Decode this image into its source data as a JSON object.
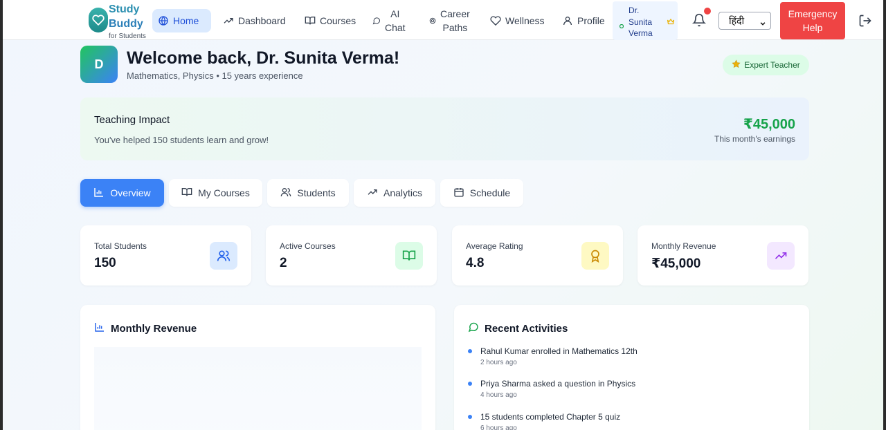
{
  "brand": {
    "line1": "Study",
    "line2": "Buddy",
    "subtitle": "for Students"
  },
  "nav": {
    "home": "Home",
    "dashboard": "Dashboard",
    "courses": "Courses",
    "ai_chat": [
      "AI",
      "Chat"
    ],
    "career_paths": [
      "Career",
      "Paths"
    ],
    "wellness": "Wellness",
    "profile": "Profile"
  },
  "user_chip": {
    "name_lines": [
      "Dr.",
      "Sunita",
      "Verma"
    ]
  },
  "language": {
    "selected": "हिंदी"
  },
  "emergency": {
    "lines": [
      "Emergency",
      "Help"
    ]
  },
  "welcome": {
    "avatar_letter": "D",
    "title": "Welcome back, Dr. Sunita Verma!",
    "subtitle": "Mathematics, Physics • 15 years experience",
    "badge": "Expert Teacher"
  },
  "impact": {
    "title": "Teaching Impact",
    "subtitle": "You've helped 150 students learn and grow!",
    "amount": "₹45,000",
    "caption": "This month's earnings"
  },
  "tabs": [
    "Overview",
    "My Courses",
    "Students",
    "Analytics",
    "Schedule"
  ],
  "stats": [
    {
      "label": "Total Students",
      "value": "150",
      "icon": "users-icon",
      "bg": "#dbeafe",
      "color": "#2563eb"
    },
    {
      "label": "Active Courses",
      "value": "2",
      "icon": "book-open-icon",
      "bg": "#dcfce7",
      "color": "#16a34a"
    },
    {
      "label": "Average Rating",
      "value": "4.8",
      "icon": "award-icon",
      "bg": "#fef9c3",
      "color": "#ca8a04"
    },
    {
      "label": "Monthly Revenue",
      "value": "₹45,000",
      "icon": "trending-up-icon",
      "bg": "#f3e8ff",
      "color": "#9333ea"
    }
  ],
  "revenue_panel": {
    "title": "Monthly Revenue"
  },
  "activities_panel": {
    "title": "Recent Activities",
    "items": [
      {
        "text": "Rahul Kumar enrolled in Mathematics 12th",
        "time": "2 hours ago"
      },
      {
        "text": "Priya Sharma asked a question in Physics",
        "time": "4 hours ago"
      },
      {
        "text": "15 students completed Chapter 5 quiz",
        "time": "6 hours ago"
      }
    ]
  },
  "colors": {
    "primary": "#3b82f6",
    "success": "#16a34a",
    "danger": "#ef4444"
  }
}
